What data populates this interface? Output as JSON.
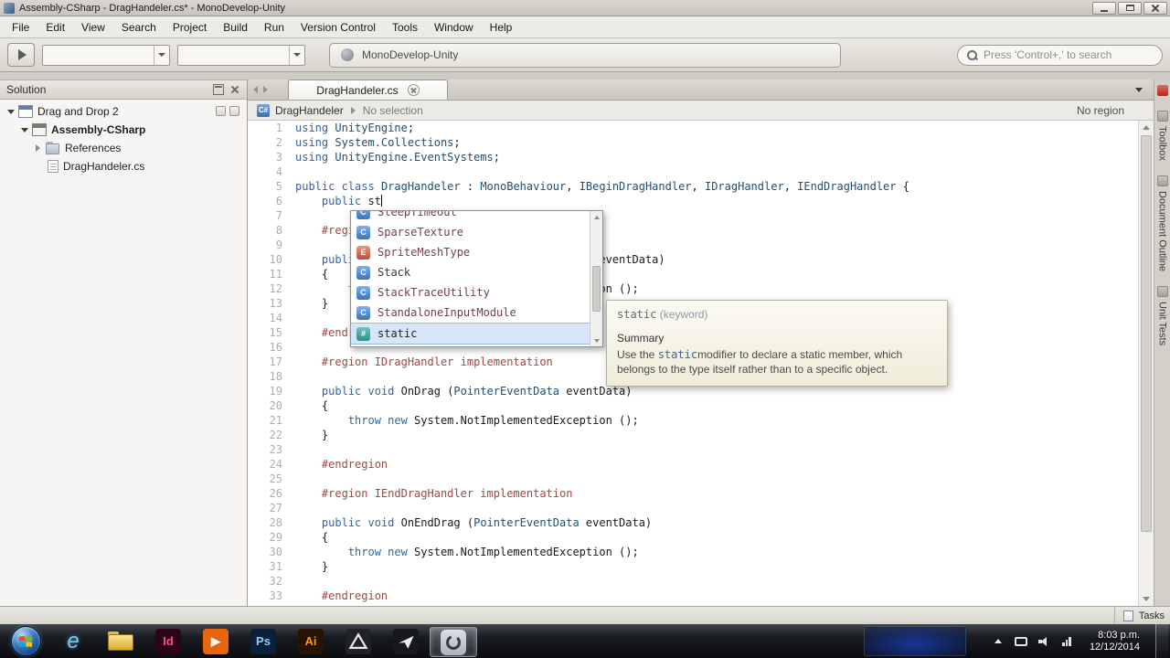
{
  "window": {
    "title": "Assembly-CSharp - DragHandeler.cs* - MonoDevelop-Unity"
  },
  "menu": {
    "items": [
      "File",
      "Edit",
      "View",
      "Search",
      "Project",
      "Build",
      "Run",
      "Version Control",
      "Tools",
      "Window",
      "Help"
    ]
  },
  "toolbar": {
    "status_text": "MonoDevelop-Unity",
    "search_placeholder": "Press 'Control+,' to search",
    "combo1_value": "",
    "combo2_value": ""
  },
  "solution_pad": {
    "title": "Solution",
    "tree": [
      {
        "label": "Drag and Drop 2",
        "level": 0,
        "expander": "open",
        "icon": "solution",
        "bold": false,
        "actions": true
      },
      {
        "label": "Assembly-CSharp",
        "level": 1,
        "expander": "open",
        "icon": "project",
        "bold": true
      },
      {
        "label": "References",
        "level": 2,
        "expander": "closed",
        "icon": "references",
        "bold": false
      },
      {
        "label": "DragHandeler.cs",
        "level": 2,
        "expander": null,
        "icon": "file",
        "bold": false
      }
    ]
  },
  "editor": {
    "tab_label": "DragHandeler.cs",
    "breadcrumb": {
      "icon_text": "C#",
      "class_name": "DragHandeler",
      "selection": "No selection",
      "region": "No region"
    },
    "lines": [
      {
        "n": 1,
        "t": [
          [
            "kw",
            "using"
          ],
          [
            "pl",
            " "
          ],
          [
            "ty",
            "UnityEngine"
          ],
          [
            "pl",
            ";"
          ]
        ]
      },
      {
        "n": 2,
        "t": [
          [
            "kw",
            "using"
          ],
          [
            "pl",
            " "
          ],
          [
            "ty",
            "System.Collections"
          ],
          [
            "pl",
            ";"
          ]
        ]
      },
      {
        "n": 3,
        "t": [
          [
            "kw",
            "using"
          ],
          [
            "pl",
            " "
          ],
          [
            "ty",
            "UnityEngine.EventSystems"
          ],
          [
            "pl",
            ";"
          ]
        ]
      },
      {
        "n": 4,
        "t": []
      },
      {
        "n": 5,
        "t": [
          [
            "kw",
            "public class"
          ],
          [
            "pl",
            " "
          ],
          [
            "ty",
            "DragHandeler"
          ],
          [
            "pl",
            " : "
          ],
          [
            "ty",
            "MonoBehaviour"
          ],
          [
            "pl",
            ", "
          ],
          [
            "ty",
            "IBeginDragHandler"
          ],
          [
            "pl",
            ", "
          ],
          [
            "ty",
            "IDragHandler"
          ],
          [
            "pl",
            ", "
          ],
          [
            "ty",
            "IEndDragHandler"
          ],
          [
            "pl",
            " {"
          ]
        ]
      },
      {
        "n": 6,
        "t": [
          [
            "pl",
            "    "
          ],
          [
            "kw",
            "public"
          ],
          [
            "pl",
            " st"
          ]
        ],
        "cursor": true
      },
      {
        "n": 7,
        "t": []
      },
      {
        "n": 8,
        "t": [
          [
            "pl",
            "    "
          ],
          [
            "rg",
            "#region IBeginDragHandler implementation"
          ]
        ]
      },
      {
        "n": 9,
        "t": []
      },
      {
        "n": 10,
        "t": [
          [
            "pl",
            "    "
          ],
          [
            "kw",
            "public void"
          ],
          [
            "pl",
            " OnBeginDrag ("
          ],
          [
            "ty",
            "PointerEventData"
          ],
          [
            "pl",
            " eventData)"
          ]
        ]
      },
      {
        "n": 11,
        "t": [
          [
            "pl",
            "    {"
          ]
        ]
      },
      {
        "n": 12,
        "t": [
          [
            "pl",
            "        "
          ],
          [
            "kw",
            "throw new"
          ],
          [
            "pl",
            " System.NotImplementedException ();"
          ]
        ]
      },
      {
        "n": 13,
        "t": [
          [
            "pl",
            "    }"
          ]
        ]
      },
      {
        "n": 14,
        "t": []
      },
      {
        "n": 15,
        "t": [
          [
            "pl",
            "    "
          ],
          [
            "rg",
            "#endregion"
          ]
        ]
      },
      {
        "n": 16,
        "t": []
      },
      {
        "n": 17,
        "t": [
          [
            "pl",
            "    "
          ],
          [
            "rg",
            "#region IDragHandler implementation"
          ]
        ]
      },
      {
        "n": 18,
        "t": []
      },
      {
        "n": 19,
        "t": [
          [
            "pl",
            "    "
          ],
          [
            "kw",
            "public void"
          ],
          [
            "pl",
            " OnDrag ("
          ],
          [
            "ty",
            "PointerEventData"
          ],
          [
            "pl",
            " eventData)"
          ]
        ]
      },
      {
        "n": 20,
        "t": [
          [
            "pl",
            "    {"
          ]
        ]
      },
      {
        "n": 21,
        "t": [
          [
            "pl",
            "        "
          ],
          [
            "kw",
            "throw new"
          ],
          [
            "pl",
            " System.NotImplementedException ();"
          ]
        ]
      },
      {
        "n": 22,
        "t": [
          [
            "pl",
            "    }"
          ]
        ]
      },
      {
        "n": 23,
        "t": []
      },
      {
        "n": 24,
        "t": [
          [
            "pl",
            "    "
          ],
          [
            "rg",
            "#endregion"
          ]
        ]
      },
      {
        "n": 25,
        "t": []
      },
      {
        "n": 26,
        "t": [
          [
            "pl",
            "    "
          ],
          [
            "rg",
            "#region IEndDragHandler implementation"
          ]
        ]
      },
      {
        "n": 27,
        "t": []
      },
      {
        "n": 28,
        "t": [
          [
            "pl",
            "    "
          ],
          [
            "kw",
            "public void"
          ],
          [
            "pl",
            " OnEndDrag ("
          ],
          [
            "ty",
            "PointerEventData"
          ],
          [
            "pl",
            " eventData)"
          ]
        ]
      },
      {
        "n": 29,
        "t": [
          [
            "pl",
            "    {"
          ]
        ]
      },
      {
        "n": 30,
        "t": [
          [
            "pl",
            "        "
          ],
          [
            "kw",
            "throw new"
          ],
          [
            "pl",
            " System.NotImplementedException ();"
          ]
        ]
      },
      {
        "n": 31,
        "t": [
          [
            "pl",
            "    }"
          ]
        ]
      },
      {
        "n": 32,
        "t": []
      },
      {
        "n": 33,
        "t": [
          [
            "pl",
            "    "
          ],
          [
            "rg",
            "#endregion"
          ]
        ]
      }
    ]
  },
  "completion": {
    "items": [
      {
        "label": "SleepTimeout",
        "kind": "class",
        "icon_letter": "C"
      },
      {
        "label": "SparseTexture",
        "kind": "class",
        "icon_letter": "C"
      },
      {
        "label": "SpriteMeshType",
        "kind": "enum",
        "icon_letter": "E"
      },
      {
        "label": "Stack",
        "kind": "class",
        "icon_letter": "C",
        "color": "#3a3a3a"
      },
      {
        "label": "StackTraceUtility",
        "kind": "class",
        "icon_letter": "C"
      },
      {
        "label": "StandaloneInputModule",
        "kind": "class",
        "icon_letter": "C"
      },
      {
        "label": "static",
        "kind": "keyword",
        "icon_letter": "#",
        "color": "#222222",
        "selected": true
      }
    ]
  },
  "tooltip": {
    "title_code": "static",
    "title_rest": " (keyword)",
    "summary_heading": "Summary",
    "body_pre": "Use the ",
    "body_code": "static",
    "body_post": "modifier to declare a static member, which belongs to the type itself rather than to a specific object."
  },
  "right_tabs": [
    {
      "label": "Toolbox"
    },
    {
      "label": "Document Outline"
    },
    {
      "label": "Unit Tests"
    }
  ],
  "statusbar": {
    "tasks_label": "Tasks"
  },
  "taskbar": {
    "buttons": [
      {
        "name": "start-button",
        "shape": "orb"
      },
      {
        "name": "internet-explorer-icon",
        "label": "e",
        "fg": "#7cc7f0",
        "style": "ie"
      },
      {
        "name": "windows-explorer-icon",
        "shape": "folder"
      },
      {
        "name": "indesign-icon",
        "label": "Id",
        "fg": "#ff4d92",
        "bg": "#2f0317"
      },
      {
        "name": "media-app-icon",
        "label": "▶",
        "fg": "#ffffff",
        "bg": "#e8650d"
      },
      {
        "name": "photoshop-icon",
        "label": "Ps",
        "fg": "#8fd0f2",
        "bg": "#0a1f38"
      },
      {
        "name": "illustrator-icon",
        "label": "Ai",
        "fg": "#ff9a00",
        "bg": "#271203"
      },
      {
        "name": "unity-icon",
        "shape": "unity"
      },
      {
        "name": "unity-editor-icon",
        "shape": "plane"
      },
      {
        "name": "monodevelop-icon",
        "shape": "mono",
        "active": true
      }
    ],
    "clock_time": "8:03 p.m.",
    "clock_date": "12/12/2014"
  },
  "colors": {
    "keyword": "#3465a4",
    "type": "#1f4f72",
    "region": "#a04545",
    "completion_text": "#7d3c44",
    "selection": "#d6e6f8"
  }
}
